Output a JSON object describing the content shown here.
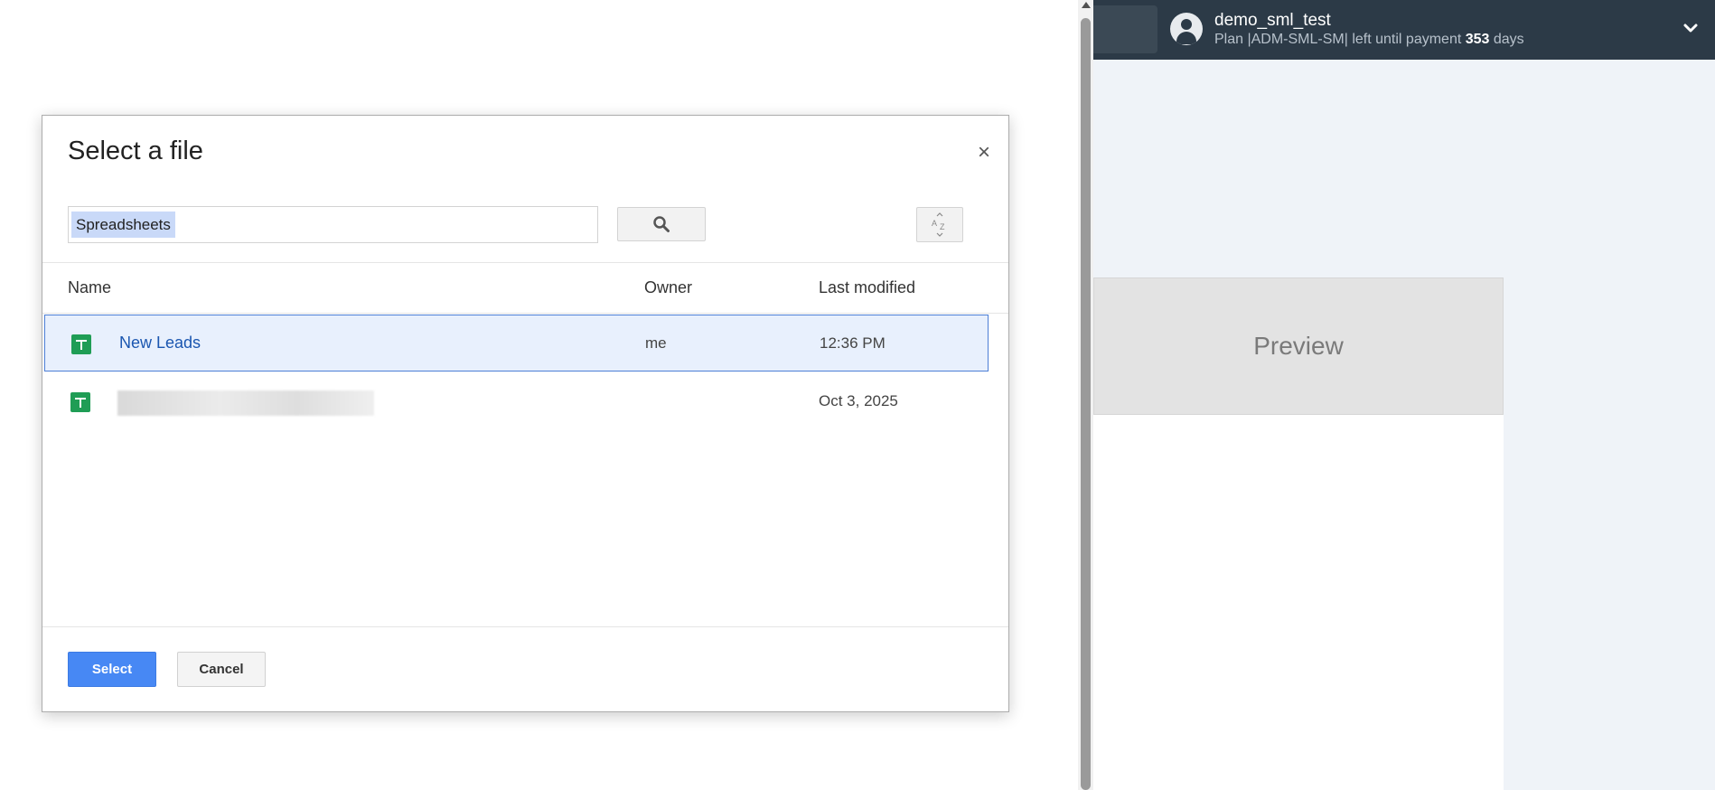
{
  "app": {
    "user_name": "demo_sml_test",
    "plan_prefix": "Plan |ADM-SML-SM| left until payment ",
    "plan_days": "353",
    "plan_suffix": " days",
    "preview_label": "Preview"
  },
  "dialog": {
    "title": "Select a file",
    "close_label": "×",
    "search_value": "Spreadsheets",
    "columns": {
      "name": "Name",
      "owner": "Owner",
      "modified": "Last modified"
    },
    "files": [
      {
        "name": "New Leads",
        "owner": "me",
        "modified": "12:36 PM",
        "selected": true
      },
      {
        "name": "",
        "owner": "",
        "modified": "Oct 3, 2025",
        "selected": false,
        "redacted": true
      }
    ],
    "select_label": "Select",
    "cancel_label": "Cancel"
  },
  "icons": {
    "search": "search-icon",
    "sort": "sort-az-icon",
    "spreadsheet": "spreadsheet-icon",
    "avatar": "user-avatar-icon",
    "chevron": "chevron-down-icon"
  },
  "colors": {
    "topbar": "#2c3a47",
    "accent": "#4788f4",
    "selection": "#e8f0fd",
    "sheet_green": "#1f9d55"
  }
}
